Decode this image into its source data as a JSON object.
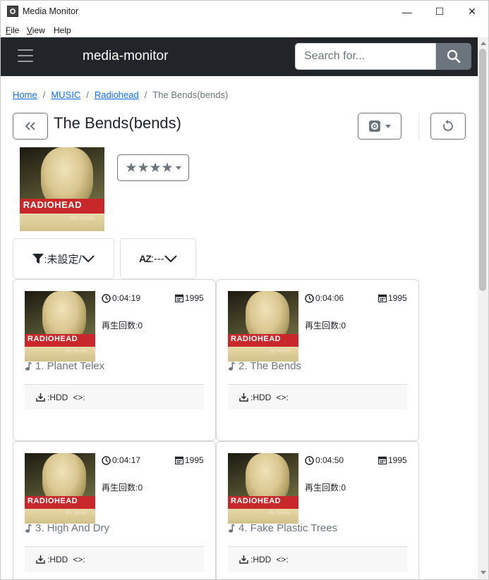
{
  "window": {
    "title": "Media Monitor",
    "minimize": "—",
    "maximize": "☐",
    "close": "✕"
  },
  "menu": {
    "file": "File",
    "file_key": "F",
    "file_rest": "ile",
    "view_key": "V",
    "view_rest": "iew",
    "help": "Help"
  },
  "navbar": {
    "brand": "media-monitor",
    "search_placeholder": "Search for..."
  },
  "breadcrumb": {
    "home": "Home",
    "music": "MUSIC",
    "artist": "Radiohead",
    "current": "The Bends(bends)",
    "separator": "/"
  },
  "album": {
    "title": "The Bends(bends)",
    "rating_stars": "★★★★",
    "rating_value": 4,
    "cover_band": "RADIOHEAD",
    "cover_sub": "the bends"
  },
  "filters": {
    "filter_label": ":未設定/",
    "sort_label": ":---",
    "sort_icon": "AZ"
  },
  "tracks": [
    {
      "title": "1. Planet Telex",
      "duration": "0:04:19",
      "year": "1995",
      "plays": "再生回数:0",
      "source": ":HDD",
      "code": "<>:"
    },
    {
      "title": "2. The Bends",
      "duration": "0:04:06",
      "year": "1995",
      "plays": "再生回数:0",
      "source": ":HDD",
      "code": "<>:"
    },
    {
      "title": "3. High And Dry",
      "duration": "0:04:17",
      "year": "1995",
      "plays": "再生回数:0",
      "source": ":HDD",
      "code": "<>:"
    },
    {
      "title": "4. Fake Plastic Trees",
      "duration": "0:04:50",
      "year": "1995",
      "plays": "再生回数:0",
      "source": ":HDD",
      "code": "<>:"
    }
  ],
  "icons": {
    "app": "media-monitor-icon",
    "menu": "hamburger-icon",
    "search": "search-icon",
    "back": "double-chevron-left-icon",
    "settings": "gear-icon",
    "refresh": "refresh-icon",
    "filter": "filter-icon",
    "sort": "sort-az-icon",
    "clock": "clock-icon",
    "calendar": "calendar-icon",
    "note": "music-note-icon",
    "download": "download-icon"
  },
  "colors": {
    "navbar": "#212529",
    "link": "#0d6efd",
    "muted": "#6c757d"
  }
}
